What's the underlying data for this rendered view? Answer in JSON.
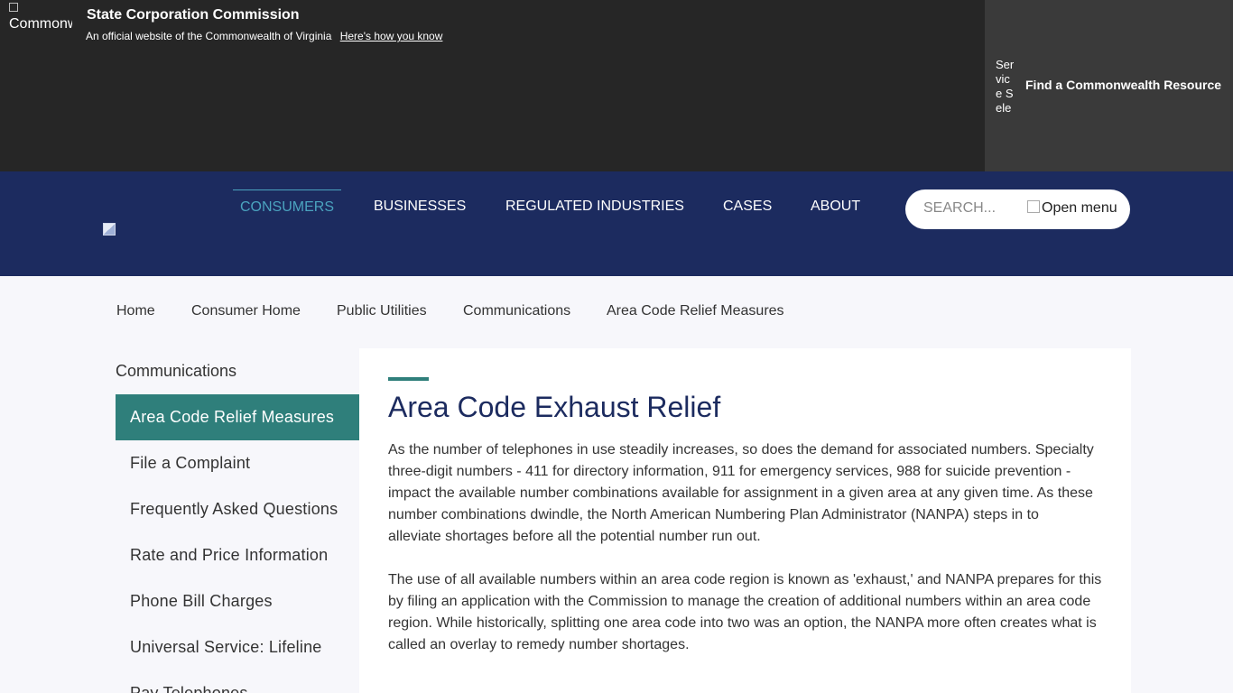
{
  "banner": {
    "logo_alt": "Commonwealth",
    "agency": "State Corporation Commission",
    "official_text": "An official website of the Commonwealth of Virginia",
    "how_link": "Here's how you know",
    "resource_icon_alt": "Service Select Icon",
    "resource_label": "Find a Commonwealth Resource"
  },
  "nav": {
    "items": [
      "CONSUMERS",
      "BUSINESSES",
      "REGULATED INDUSTRIES",
      "CASES",
      "ABOUT"
    ],
    "active": "CONSUMERS",
    "search_placeholder": "SEARCH...",
    "menu_alt": "Open menu"
  },
  "breadcrumb": [
    "Home",
    "Consumer Home",
    "Public Utilities",
    "Communications",
    "Area Code Relief Measures"
  ],
  "sidebar": {
    "title": "Communications",
    "items": [
      "Area Code Relief Measures",
      "File a Complaint",
      "Frequently Asked Questions",
      "Rate and Price Information",
      "Phone Bill Charges",
      "Universal Service: Lifeline",
      "Pay Telephones"
    ],
    "active": "Area Code Relief Measures"
  },
  "content": {
    "title": "Area Code Exhaust Relief",
    "paragraph1_lines": [
      "As the number of telephones in use steadily increases, so does the demand for associated numbers. Specialty",
      "three-digit numbers - 411 for directory information, 911 for emergency services, 988 for suicide prevention -",
      "impact the available number combinations available for assignment in a given area at any given time. As these",
      "number combinations dwindle, the North American Numbering Plan Administrator (NANPA) steps in to",
      "alleviate shortages before all the potential number run out."
    ],
    "paragraph2_lines": [
      "The use of all available numbers within an area code region is known as 'exhaust,' and NANPA prepares for this",
      "by filing an application with the Commission to manage the creation of additional numbers within an area code",
      "region. While historically, splitting one area code into two was an option, the NANPA more often creates what is",
      "called an overlay to remedy number shortages."
    ]
  },
  "colors": {
    "topbar": "#262626",
    "navbar": "#1c2b5f",
    "accent": "#2f7f7b",
    "active_nav": "#4ba3bf"
  }
}
